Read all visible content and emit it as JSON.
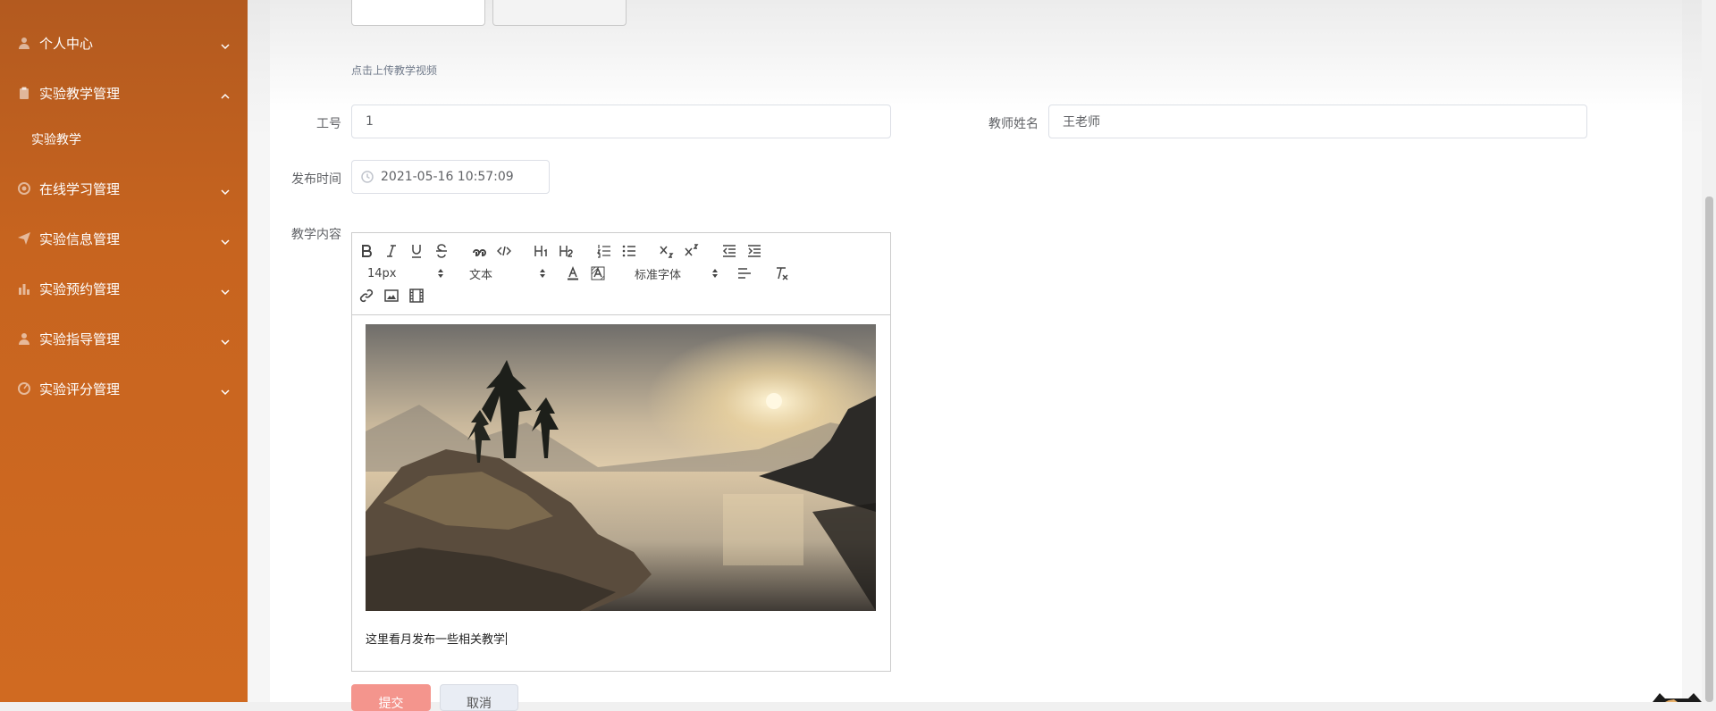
{
  "sidebar": {
    "items": [
      {
        "label": "个人中心",
        "icon": "user-icon",
        "expanded": false
      },
      {
        "label": "实验教学管理",
        "icon": "clipboard-icon",
        "expanded": true
      },
      {
        "label": "在线学习管理",
        "icon": "circle-icon",
        "expanded": false
      },
      {
        "label": "实验信息管理",
        "icon": "send-icon",
        "expanded": false
      },
      {
        "label": "实验预约管理",
        "icon": "bar-chart-icon",
        "expanded": false
      },
      {
        "label": "实验指导管理",
        "icon": "user-icon",
        "expanded": false
      },
      {
        "label": "实验评分管理",
        "icon": "dashboard-icon",
        "expanded": false
      }
    ],
    "submenu": {
      "label": "实验教学"
    },
    "colors": {
      "background": "#c7641f",
      "text": "#ffffff"
    }
  },
  "form": {
    "upload_hint": "点击上传教学视频",
    "job_no": {
      "label": "工号",
      "value": "1"
    },
    "teacher_name": {
      "label": "教师姓名",
      "value": "王老师"
    },
    "publish_time": {
      "label": "发布时间",
      "value": "2021-05-16 10:57:09"
    },
    "content": {
      "label": "教学内容",
      "text": "这里看月发布一些相关教学"
    }
  },
  "editor": {
    "toolbar": {
      "font_size": "14px",
      "header_select": "文本",
      "font_family": "标准字体",
      "buttons": [
        "bold-icon",
        "italic-icon",
        "underline-icon",
        "strike-icon",
        "blockquote-icon",
        "code-block-icon",
        "h1-icon",
        "h2-icon",
        "ordered-list-icon",
        "bullet-list-icon",
        "subscript-icon",
        "superscript-icon",
        "outdent-icon",
        "indent-icon",
        "font-color-icon",
        "background-color-icon",
        "align-icon",
        "clean-format-icon",
        "link-icon",
        "image-icon",
        "video-icon"
      ]
    },
    "image": {
      "description": "landscape-photo"
    }
  },
  "actions": {
    "submit": "提交",
    "cancel": "取消"
  },
  "colors": {
    "accent": "#c7641f",
    "submit_button": "#f4958d",
    "cancel_button": "#e9edf4"
  }
}
